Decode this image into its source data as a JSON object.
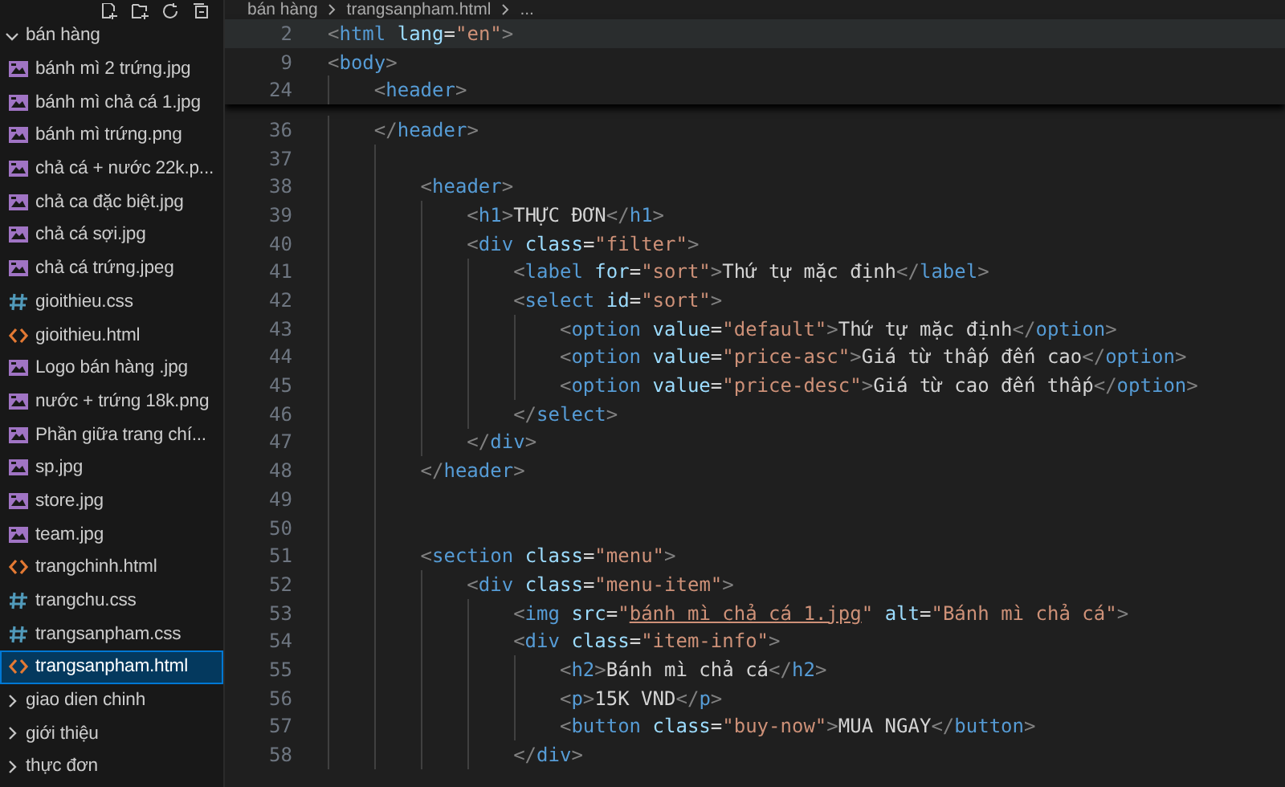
{
  "explorer": {
    "tree": [
      {
        "name": "bán hàng",
        "kind": "folder",
        "expanded": true,
        "selected": false,
        "children": [
          {
            "name": "bánh mì 2 trứng.jpg",
            "kind": "image",
            "selected": false
          },
          {
            "name": "bánh mì chả cá 1.jpg",
            "kind": "image",
            "selected": false
          },
          {
            "name": "bánh mì trứng.png",
            "kind": "image",
            "selected": false
          },
          {
            "name": "chả cá + nước 22k.p...",
            "kind": "image",
            "selected": false
          },
          {
            "name": "chả ca đặc biệt.jpg",
            "kind": "image",
            "selected": false
          },
          {
            "name": "chả cá sợi.jpg",
            "kind": "image",
            "selected": false
          },
          {
            "name": "chả cá trứng.jpeg",
            "kind": "image",
            "selected": false
          },
          {
            "name": "gioithieu.css",
            "kind": "css",
            "selected": false
          },
          {
            "name": "gioithieu.html",
            "kind": "html",
            "selected": false
          },
          {
            "name": "Logo bán hàng .jpg",
            "kind": "image",
            "selected": false
          },
          {
            "name": "nước + trứng 18k.png",
            "kind": "image",
            "selected": false
          },
          {
            "name": "Phần giữa trang chí...",
            "kind": "image",
            "selected": false
          },
          {
            "name": "sp.jpg",
            "kind": "image",
            "selected": false
          },
          {
            "name": "store.jpg",
            "kind": "image",
            "selected": false
          },
          {
            "name": "team.jpg",
            "kind": "image",
            "selected": false
          },
          {
            "name": "trangchinh.html",
            "kind": "html",
            "selected": false
          },
          {
            "name": "trangchu.css",
            "kind": "css",
            "selected": false
          },
          {
            "name": "trangsanpham.css",
            "kind": "css",
            "selected": false
          },
          {
            "name": "trangsanpham.html",
            "kind": "html",
            "selected": true
          }
        ]
      },
      {
        "name": "giao dien chinh",
        "kind": "folder",
        "expanded": false,
        "selected": false
      },
      {
        "name": "giới thiệu",
        "kind": "folder",
        "expanded": false,
        "selected": false
      },
      {
        "name": "thực đơn",
        "kind": "folder",
        "expanded": false,
        "selected": false
      }
    ]
  },
  "breadcrumb": [
    "bán hàng",
    "trangsanpham.html",
    "..."
  ],
  "sticky_lines": [
    {
      "number": "2",
      "hovered": true,
      "tokens": [
        {
          "kind": "punct",
          "text": "<"
        },
        {
          "kind": "tag",
          "text": "html"
        },
        {
          "kind": "attr",
          "text": "lang",
          "space": true
        },
        {
          "kind": "eq",
          "text": "="
        },
        {
          "kind": "str",
          "text": "\"en\""
        },
        {
          "kind": "punct",
          "text": ">"
        }
      ]
    },
    {
      "number": "9",
      "hovered": false,
      "tokens": [
        {
          "kind": "punct",
          "text": "<"
        },
        {
          "kind": "tag",
          "text": "body"
        },
        {
          "kind": "punct",
          "text": ">"
        }
      ]
    },
    {
      "number": "24",
      "hovered": false,
      "tokens": [
        {
          "kind": "indent"
        },
        {
          "kind": "punct",
          "text": "<"
        },
        {
          "kind": "tag",
          "text": "header"
        },
        {
          "kind": "punct",
          "text": ">"
        }
      ]
    }
  ],
  "lines": [
    {
      "number": "36",
      "tokens": [
        {
          "kind": "indent"
        },
        {
          "kind": "punct",
          "text": "</"
        },
        {
          "kind": "tag",
          "text": "header"
        },
        {
          "kind": "punct",
          "text": ">"
        }
      ]
    },
    {
      "number": "37",
      "tokens": [
        {
          "kind": "indent"
        },
        {
          "kind": "indent"
        }
      ]
    },
    {
      "number": "38",
      "tokens": [
        {
          "kind": "indent"
        },
        {
          "kind": "indent"
        },
        {
          "kind": "punct",
          "text": "<"
        },
        {
          "kind": "tag",
          "text": "header"
        },
        {
          "kind": "punct",
          "text": ">"
        }
      ]
    },
    {
      "number": "39",
      "tokens": [
        {
          "kind": "indent"
        },
        {
          "kind": "indent"
        },
        {
          "kind": "indent"
        },
        {
          "kind": "punct",
          "text": "<"
        },
        {
          "kind": "tag",
          "text": "h1"
        },
        {
          "kind": "punct",
          "text": ">"
        },
        {
          "kind": "text",
          "text": "THỰC ĐƠN"
        },
        {
          "kind": "punct",
          "text": "</"
        },
        {
          "kind": "tag",
          "text": "h1"
        },
        {
          "kind": "punct",
          "text": ">"
        }
      ]
    },
    {
      "number": "40",
      "tokens": [
        {
          "kind": "indent"
        },
        {
          "kind": "indent"
        },
        {
          "kind": "indent"
        },
        {
          "kind": "punct",
          "text": "<"
        },
        {
          "kind": "tag",
          "text": "div"
        },
        {
          "kind": "attr",
          "text": "class",
          "space": true
        },
        {
          "kind": "eq",
          "text": "="
        },
        {
          "kind": "str",
          "text": "\"filter\""
        },
        {
          "kind": "punct",
          "text": ">"
        }
      ]
    },
    {
      "number": "41",
      "tokens": [
        {
          "kind": "indent"
        },
        {
          "kind": "indent"
        },
        {
          "kind": "indent"
        },
        {
          "kind": "indent"
        },
        {
          "kind": "punct",
          "text": "<"
        },
        {
          "kind": "tag",
          "text": "label"
        },
        {
          "kind": "attr",
          "text": "for",
          "space": true
        },
        {
          "kind": "eq",
          "text": "="
        },
        {
          "kind": "str",
          "text": "\"sort\""
        },
        {
          "kind": "punct",
          "text": ">"
        },
        {
          "kind": "text",
          "text": "Thứ tự mặc định"
        },
        {
          "kind": "punct",
          "text": "</"
        },
        {
          "kind": "tag",
          "text": "label"
        },
        {
          "kind": "punct",
          "text": ">"
        }
      ]
    },
    {
      "number": "42",
      "tokens": [
        {
          "kind": "indent"
        },
        {
          "kind": "indent"
        },
        {
          "kind": "indent"
        },
        {
          "kind": "indent"
        },
        {
          "kind": "punct",
          "text": "<"
        },
        {
          "kind": "tag",
          "text": "select"
        },
        {
          "kind": "attr",
          "text": "id",
          "space": true
        },
        {
          "kind": "eq",
          "text": "="
        },
        {
          "kind": "str",
          "text": "\"sort\""
        },
        {
          "kind": "punct",
          "text": ">"
        }
      ]
    },
    {
      "number": "43",
      "tokens": [
        {
          "kind": "indent"
        },
        {
          "kind": "indent"
        },
        {
          "kind": "indent"
        },
        {
          "kind": "indent"
        },
        {
          "kind": "indent"
        },
        {
          "kind": "punct",
          "text": "<"
        },
        {
          "kind": "tag",
          "text": "option"
        },
        {
          "kind": "attr",
          "text": "value",
          "space": true
        },
        {
          "kind": "eq",
          "text": "="
        },
        {
          "kind": "str",
          "text": "\"default\""
        },
        {
          "kind": "punct",
          "text": ">"
        },
        {
          "kind": "text",
          "text": "Thứ tự mặc định"
        },
        {
          "kind": "punct",
          "text": "</"
        },
        {
          "kind": "tag",
          "text": "option"
        },
        {
          "kind": "punct",
          "text": ">"
        }
      ]
    },
    {
      "number": "44",
      "tokens": [
        {
          "kind": "indent"
        },
        {
          "kind": "indent"
        },
        {
          "kind": "indent"
        },
        {
          "kind": "indent"
        },
        {
          "kind": "indent"
        },
        {
          "kind": "punct",
          "text": "<"
        },
        {
          "kind": "tag",
          "text": "option"
        },
        {
          "kind": "attr",
          "text": "value",
          "space": true
        },
        {
          "kind": "eq",
          "text": "="
        },
        {
          "kind": "str",
          "text": "\"price-asc\""
        },
        {
          "kind": "punct",
          "text": ">"
        },
        {
          "kind": "text",
          "text": "Giá từ thấp đến cao"
        },
        {
          "kind": "punct",
          "text": "</"
        },
        {
          "kind": "tag",
          "text": "option"
        },
        {
          "kind": "punct",
          "text": ">"
        }
      ]
    },
    {
      "number": "45",
      "tokens": [
        {
          "kind": "indent"
        },
        {
          "kind": "indent"
        },
        {
          "kind": "indent"
        },
        {
          "kind": "indent"
        },
        {
          "kind": "indent"
        },
        {
          "kind": "punct",
          "text": "<"
        },
        {
          "kind": "tag",
          "text": "option"
        },
        {
          "kind": "attr",
          "text": "value",
          "space": true
        },
        {
          "kind": "eq",
          "text": "="
        },
        {
          "kind": "str",
          "text": "\"price-desc\""
        },
        {
          "kind": "punct",
          "text": ">"
        },
        {
          "kind": "text",
          "text": "Giá từ cao đến thấp"
        },
        {
          "kind": "punct",
          "text": "</"
        },
        {
          "kind": "tag",
          "text": "option"
        },
        {
          "kind": "punct",
          "text": ">"
        }
      ]
    },
    {
      "number": "46",
      "tokens": [
        {
          "kind": "indent"
        },
        {
          "kind": "indent"
        },
        {
          "kind": "indent"
        },
        {
          "kind": "indent"
        },
        {
          "kind": "punct",
          "text": "</"
        },
        {
          "kind": "tag",
          "text": "select"
        },
        {
          "kind": "punct",
          "text": ">"
        }
      ]
    },
    {
      "number": "47",
      "tokens": [
        {
          "kind": "indent"
        },
        {
          "kind": "indent"
        },
        {
          "kind": "indent"
        },
        {
          "kind": "punct",
          "text": "</"
        },
        {
          "kind": "tag",
          "text": "div"
        },
        {
          "kind": "punct",
          "text": ">"
        }
      ]
    },
    {
      "number": "48",
      "tokens": [
        {
          "kind": "indent"
        },
        {
          "kind": "indent"
        },
        {
          "kind": "punct",
          "text": "</"
        },
        {
          "kind": "tag",
          "text": "header"
        },
        {
          "kind": "punct",
          "text": ">"
        }
      ]
    },
    {
      "number": "49",
      "tokens": [
        {
          "kind": "indent"
        },
        {
          "kind": "indent"
        }
      ]
    },
    {
      "number": "50",
      "tokens": [
        {
          "kind": "indent"
        },
        {
          "kind": "indent"
        }
      ]
    },
    {
      "number": "51",
      "tokens": [
        {
          "kind": "indent"
        },
        {
          "kind": "indent"
        },
        {
          "kind": "punct",
          "text": "<"
        },
        {
          "kind": "tag",
          "text": "section"
        },
        {
          "kind": "attr",
          "text": "class",
          "space": true
        },
        {
          "kind": "eq",
          "text": "="
        },
        {
          "kind": "str",
          "text": "\"menu\""
        },
        {
          "kind": "punct",
          "text": ">"
        }
      ]
    },
    {
      "number": "52",
      "tokens": [
        {
          "kind": "indent"
        },
        {
          "kind": "indent"
        },
        {
          "kind": "indent"
        },
        {
          "kind": "punct",
          "text": "<"
        },
        {
          "kind": "tag",
          "text": "div"
        },
        {
          "kind": "attr",
          "text": "class",
          "space": true
        },
        {
          "kind": "eq",
          "text": "="
        },
        {
          "kind": "str",
          "text": "\"menu-item\""
        },
        {
          "kind": "punct",
          "text": ">"
        }
      ]
    },
    {
      "number": "53",
      "tokens": [
        {
          "kind": "indent"
        },
        {
          "kind": "indent"
        },
        {
          "kind": "indent"
        },
        {
          "kind": "indent"
        },
        {
          "kind": "punct",
          "text": "<"
        },
        {
          "kind": "tag",
          "text": "img"
        },
        {
          "kind": "attr",
          "text": "src",
          "space": true
        },
        {
          "kind": "eq",
          "text": "="
        },
        {
          "kind": "str",
          "text": "\""
        },
        {
          "kind": "link",
          "text": "bánh mì chả cá 1.jpg"
        },
        {
          "kind": "str",
          "text": "\""
        },
        {
          "kind": "attr",
          "text": "alt",
          "space": true
        },
        {
          "kind": "eq",
          "text": "="
        },
        {
          "kind": "str",
          "text": "\"Bánh mì chả cá\""
        },
        {
          "kind": "punct",
          "text": ">"
        }
      ]
    },
    {
      "number": "54",
      "tokens": [
        {
          "kind": "indent"
        },
        {
          "kind": "indent"
        },
        {
          "kind": "indent"
        },
        {
          "kind": "indent"
        },
        {
          "kind": "punct",
          "text": "<"
        },
        {
          "kind": "tag",
          "text": "div"
        },
        {
          "kind": "attr",
          "text": "class",
          "space": true
        },
        {
          "kind": "eq",
          "text": "="
        },
        {
          "kind": "str",
          "text": "\"item-info\""
        },
        {
          "kind": "punct",
          "text": ">"
        }
      ]
    },
    {
      "number": "55",
      "tokens": [
        {
          "kind": "indent"
        },
        {
          "kind": "indent"
        },
        {
          "kind": "indent"
        },
        {
          "kind": "indent"
        },
        {
          "kind": "indent"
        },
        {
          "kind": "punct",
          "text": "<"
        },
        {
          "kind": "tag",
          "text": "h2"
        },
        {
          "kind": "punct",
          "text": ">"
        },
        {
          "kind": "text",
          "text": "Bánh mì chả cá"
        },
        {
          "kind": "punct",
          "text": "</"
        },
        {
          "kind": "tag",
          "text": "h2"
        },
        {
          "kind": "punct",
          "text": ">"
        }
      ]
    },
    {
      "number": "56",
      "tokens": [
        {
          "kind": "indent"
        },
        {
          "kind": "indent"
        },
        {
          "kind": "indent"
        },
        {
          "kind": "indent"
        },
        {
          "kind": "indent"
        },
        {
          "kind": "punct",
          "text": "<"
        },
        {
          "kind": "tag",
          "text": "p"
        },
        {
          "kind": "punct",
          "text": ">"
        },
        {
          "kind": "text",
          "text": "15K VND"
        },
        {
          "kind": "punct",
          "text": "</"
        },
        {
          "kind": "tag",
          "text": "p"
        },
        {
          "kind": "punct",
          "text": ">"
        }
      ]
    },
    {
      "number": "57",
      "tokens": [
        {
          "kind": "indent"
        },
        {
          "kind": "indent"
        },
        {
          "kind": "indent"
        },
        {
          "kind": "indent"
        },
        {
          "kind": "indent"
        },
        {
          "kind": "punct",
          "text": "<"
        },
        {
          "kind": "tag",
          "text": "button"
        },
        {
          "kind": "attr",
          "text": "class",
          "space": true
        },
        {
          "kind": "eq",
          "text": "="
        },
        {
          "kind": "str",
          "text": "\"buy-now\""
        },
        {
          "kind": "punct",
          "text": ">"
        },
        {
          "kind": "text",
          "text": "MUA NGAY"
        },
        {
          "kind": "punct",
          "text": "</"
        },
        {
          "kind": "tag",
          "text": "button"
        },
        {
          "kind": "punct",
          "text": ">"
        }
      ]
    },
    {
      "number": "58",
      "tokens": [
        {
          "kind": "indent"
        },
        {
          "kind": "indent"
        },
        {
          "kind": "indent"
        },
        {
          "kind": "indent"
        },
        {
          "kind": "punct",
          "text": "</"
        },
        {
          "kind": "tag",
          "text": "div"
        },
        {
          "kind": "punct",
          "text": ">"
        }
      ]
    }
  ]
}
